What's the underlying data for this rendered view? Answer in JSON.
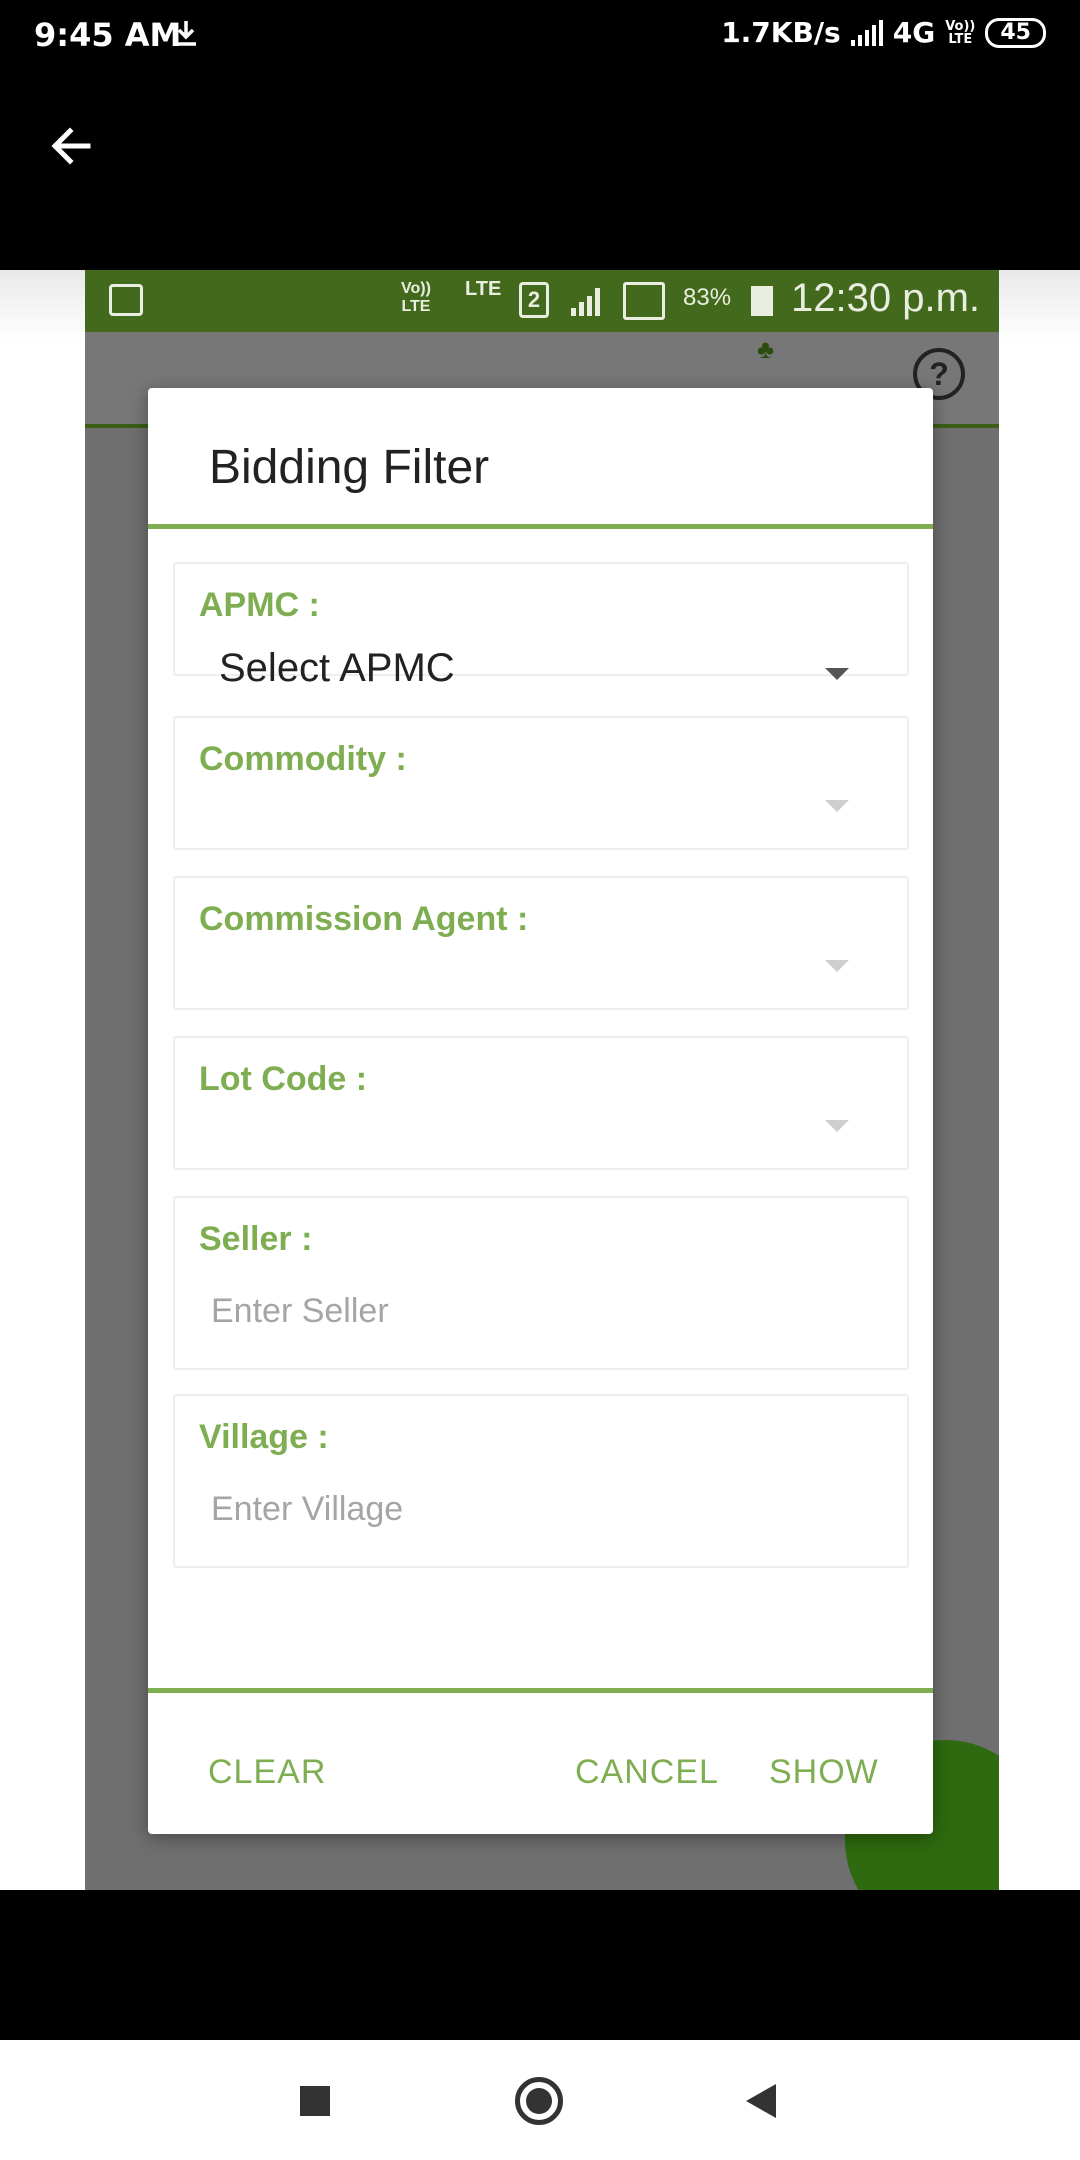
{
  "outer_status": {
    "time": "9:45 AM",
    "speed": "1.7KB/s",
    "network": "4G",
    "volte_top": "Vo))",
    "volte_bottom": "LTE",
    "battery": "45"
  },
  "inner_status": {
    "volte_top": "Vo))",
    "volte_bottom": "LTE",
    "lte": "LTE",
    "sim": "2",
    "battery_pct": "83%",
    "clock": "12:30 p.m."
  },
  "dialog": {
    "title": "Bidding Filter",
    "fields": {
      "apmc": {
        "label": "APMC :",
        "value": "Select APMC"
      },
      "commodity": {
        "label": "Commodity :",
        "value": ""
      },
      "agent": {
        "label": "Commission Agent :",
        "value": ""
      },
      "lot": {
        "label": "Lot Code :",
        "value": ""
      },
      "seller": {
        "label": "Seller :",
        "placeholder": "Enter Seller"
      },
      "village": {
        "label": "Village :",
        "placeholder": "Enter Village"
      }
    },
    "buttons": {
      "clear": "CLEAR",
      "cancel": "CANCEL",
      "show": "SHOW"
    }
  },
  "icons": {
    "outer_back": "arrow-left-icon",
    "download": "download-icon",
    "help": "help-icon",
    "nav_recent": "square-icon",
    "nav_home": "circle-icon",
    "nav_back": "triangle-left-icon"
  },
  "colors": {
    "accent": "#7fae52",
    "status_green": "#436a1c",
    "dim_overlay": "#6f6f6f"
  }
}
